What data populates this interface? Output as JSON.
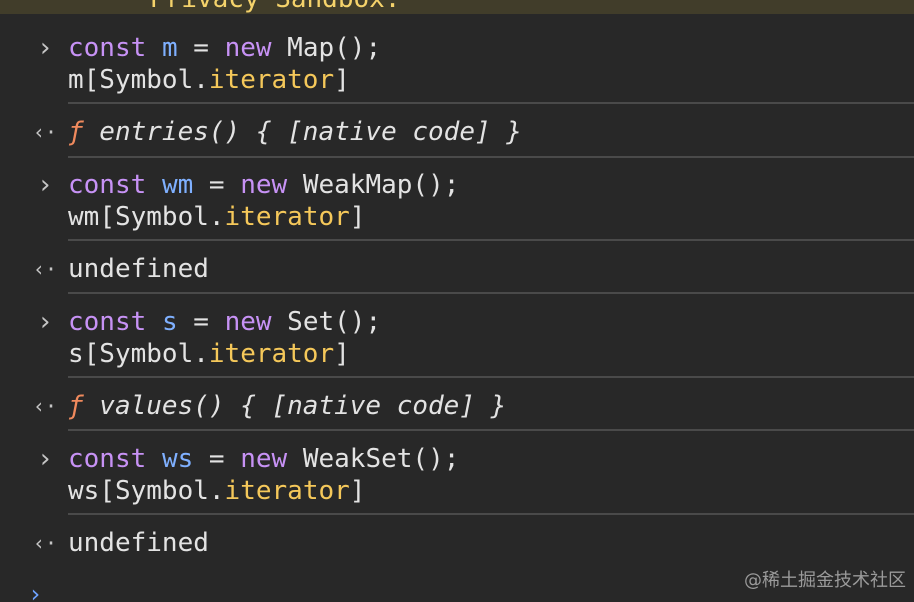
{
  "banner": {
    "text": "Privacy Sandbox."
  },
  "entries": [
    {
      "in_prompt": "›",
      "line1": {
        "kw": "const",
        "var": "m",
        "op": " = ",
        "kw2": "new",
        "rest": " Map();"
      },
      "line2": {
        "obj": "m",
        "pre": "[Symbol.",
        "prop": "iterator",
        "post": "]"
      },
      "out_prompt": "‹·",
      "out": {
        "f": "ƒ",
        "text": " entries() { [native code] }"
      }
    },
    {
      "in_prompt": "›",
      "line1": {
        "kw": "const",
        "var": "wm",
        "op": " = ",
        "kw2": "new",
        "rest": " WeakMap();"
      },
      "line2": {
        "obj": "wm",
        "pre": "[Symbol.",
        "prop": "iterator",
        "post": "]"
      },
      "out_prompt": "‹·",
      "out": {
        "undefined": "undefined"
      }
    },
    {
      "in_prompt": "›",
      "line1": {
        "kw": "const",
        "var": "s",
        "op": " = ",
        "kw2": "new",
        "rest": " Set();"
      },
      "line2": {
        "obj": "s",
        "pre": "[Symbol.",
        "prop": "iterator",
        "post": "]"
      },
      "out_prompt": "‹·",
      "out": {
        "f": "ƒ",
        "text": " values() { [native code] }"
      }
    },
    {
      "in_prompt": "›",
      "line1": {
        "kw": "const",
        "var": "ws",
        "op": " = ",
        "kw2": "new",
        "rest": " WeakSet();"
      },
      "line2": {
        "obj": "ws",
        "pre": "[Symbol.",
        "prop": "iterator",
        "post": "]"
      },
      "out_prompt": "‹·",
      "out": {
        "undefined": "undefined"
      }
    }
  ],
  "input_prompt": "›",
  "watermark": "@稀土掘金技术社区",
  "colors": {
    "background": "#282828",
    "keyword": "#c792f5",
    "variable": "#7fb0ff",
    "property": "#f5c85a",
    "function_f": "#f08a5d",
    "undefined": "#8a8a8a"
  }
}
